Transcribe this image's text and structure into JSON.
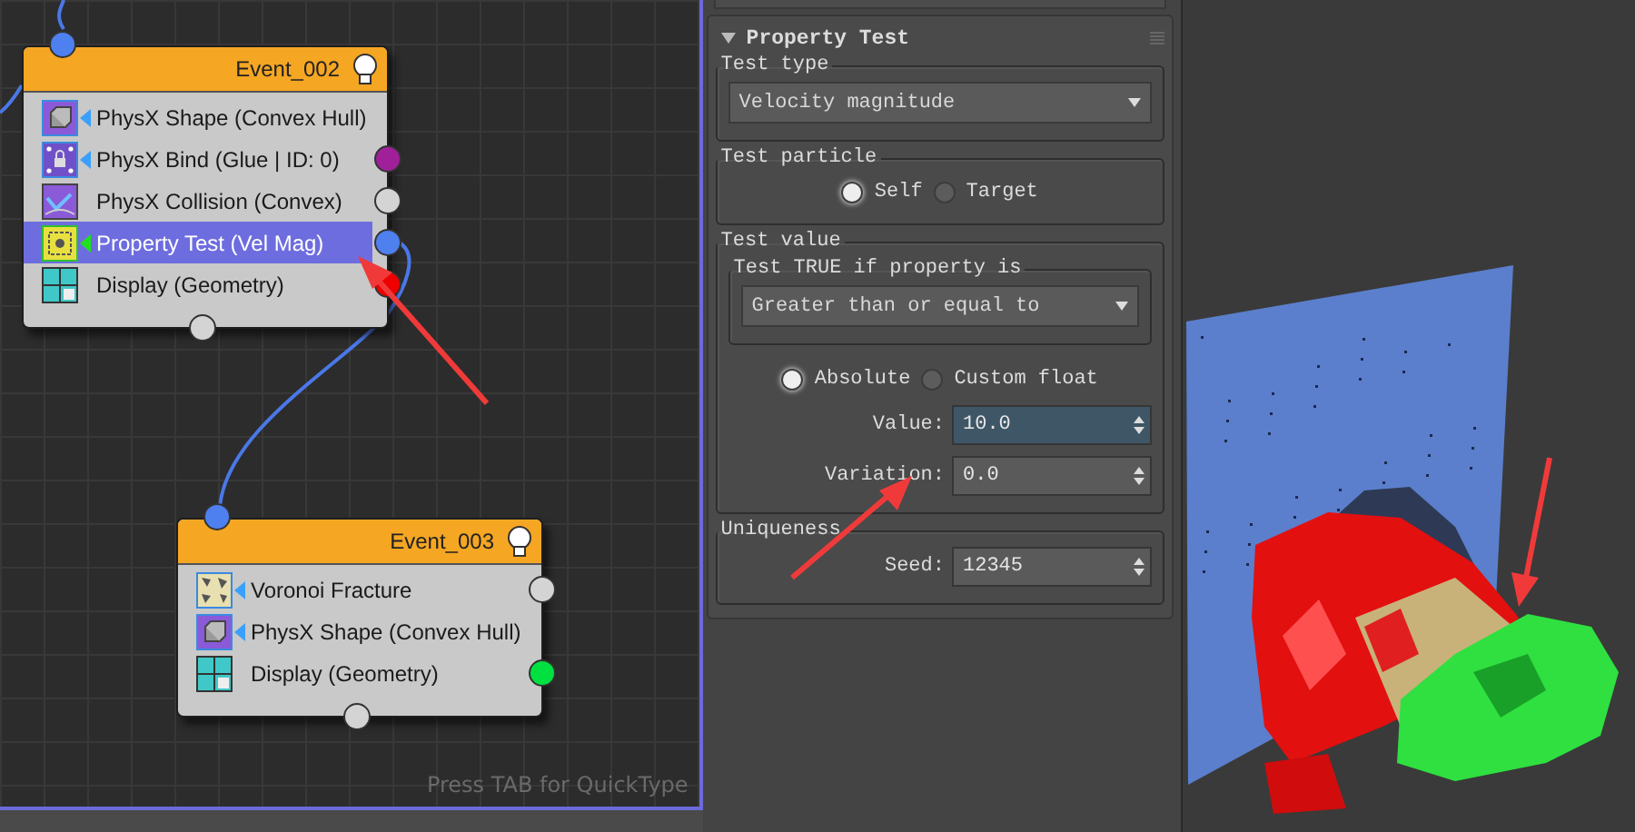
{
  "graph": {
    "nodes": [
      {
        "title": "Event_002",
        "operators": [
          {
            "label": "PhysX Shape (Convex Hull)",
            "kind": "shape",
            "selected": false
          },
          {
            "label": "PhysX Bind (Glue | ID: 0)",
            "kind": "bind",
            "selected": false,
            "color": "#a0209a"
          },
          {
            "label": "PhysX Collision (Convex)",
            "kind": "collision",
            "selected": false,
            "color": "#d4d4d4"
          },
          {
            "label": "Property Test (Vel Mag)",
            "kind": "test",
            "selected": true,
            "color": "#4f80f0"
          },
          {
            "label": "Display (Geometry)",
            "kind": "display",
            "selected": false,
            "color": "#ee0000"
          }
        ]
      },
      {
        "title": "Event_003",
        "operators": [
          {
            "label": "Voronoi Fracture",
            "kind": "voronoi",
            "selected": false,
            "color": "#d4d4d4"
          },
          {
            "label": "PhysX Shape (Convex Hull)",
            "kind": "shape",
            "selected": false
          },
          {
            "label": "Display (Geometry)",
            "kind": "display",
            "selected": false,
            "color": "#00e040"
          }
        ]
      }
    ],
    "hint": "Press TAB for QuickType"
  },
  "rollout": {
    "title": "Property Test",
    "expanded": true,
    "groups": [
      {
        "title": "Test type",
        "items": [
          {
            "kind": "dropdown",
            "value": "Velocity magnitude"
          }
        ]
      },
      {
        "title": "Test particle",
        "items": [
          {
            "kind": "radios",
            "options": [
              {
                "label": "Self",
                "selected": true
              },
              {
                "label": "Target",
                "selected": false
              }
            ]
          }
        ]
      },
      {
        "title": "Test value",
        "items": [
          {
            "kind": "group",
            "title": "Test TRUE if property is",
            "items": [
              {
                "kind": "dropdown",
                "value": "Greater than or equal to"
              }
            ]
          },
          {
            "kind": "radios",
            "options": [
              {
                "label": "Absolute",
                "selected": true
              },
              {
                "label": "Custom float",
                "selected": false
              }
            ]
          },
          {
            "kind": "spinner",
            "label": "Value:",
            "value": "10.0",
            "focused": true
          },
          {
            "kind": "spinner",
            "label": "Variation:",
            "value": "0.0",
            "focused": false
          }
        ]
      },
      {
        "title": "Uniqueness",
        "items": [
          {
            "kind": "spinner",
            "label": "Seed:",
            "value": "12345",
            "focused": false
          }
        ]
      }
    ]
  }
}
